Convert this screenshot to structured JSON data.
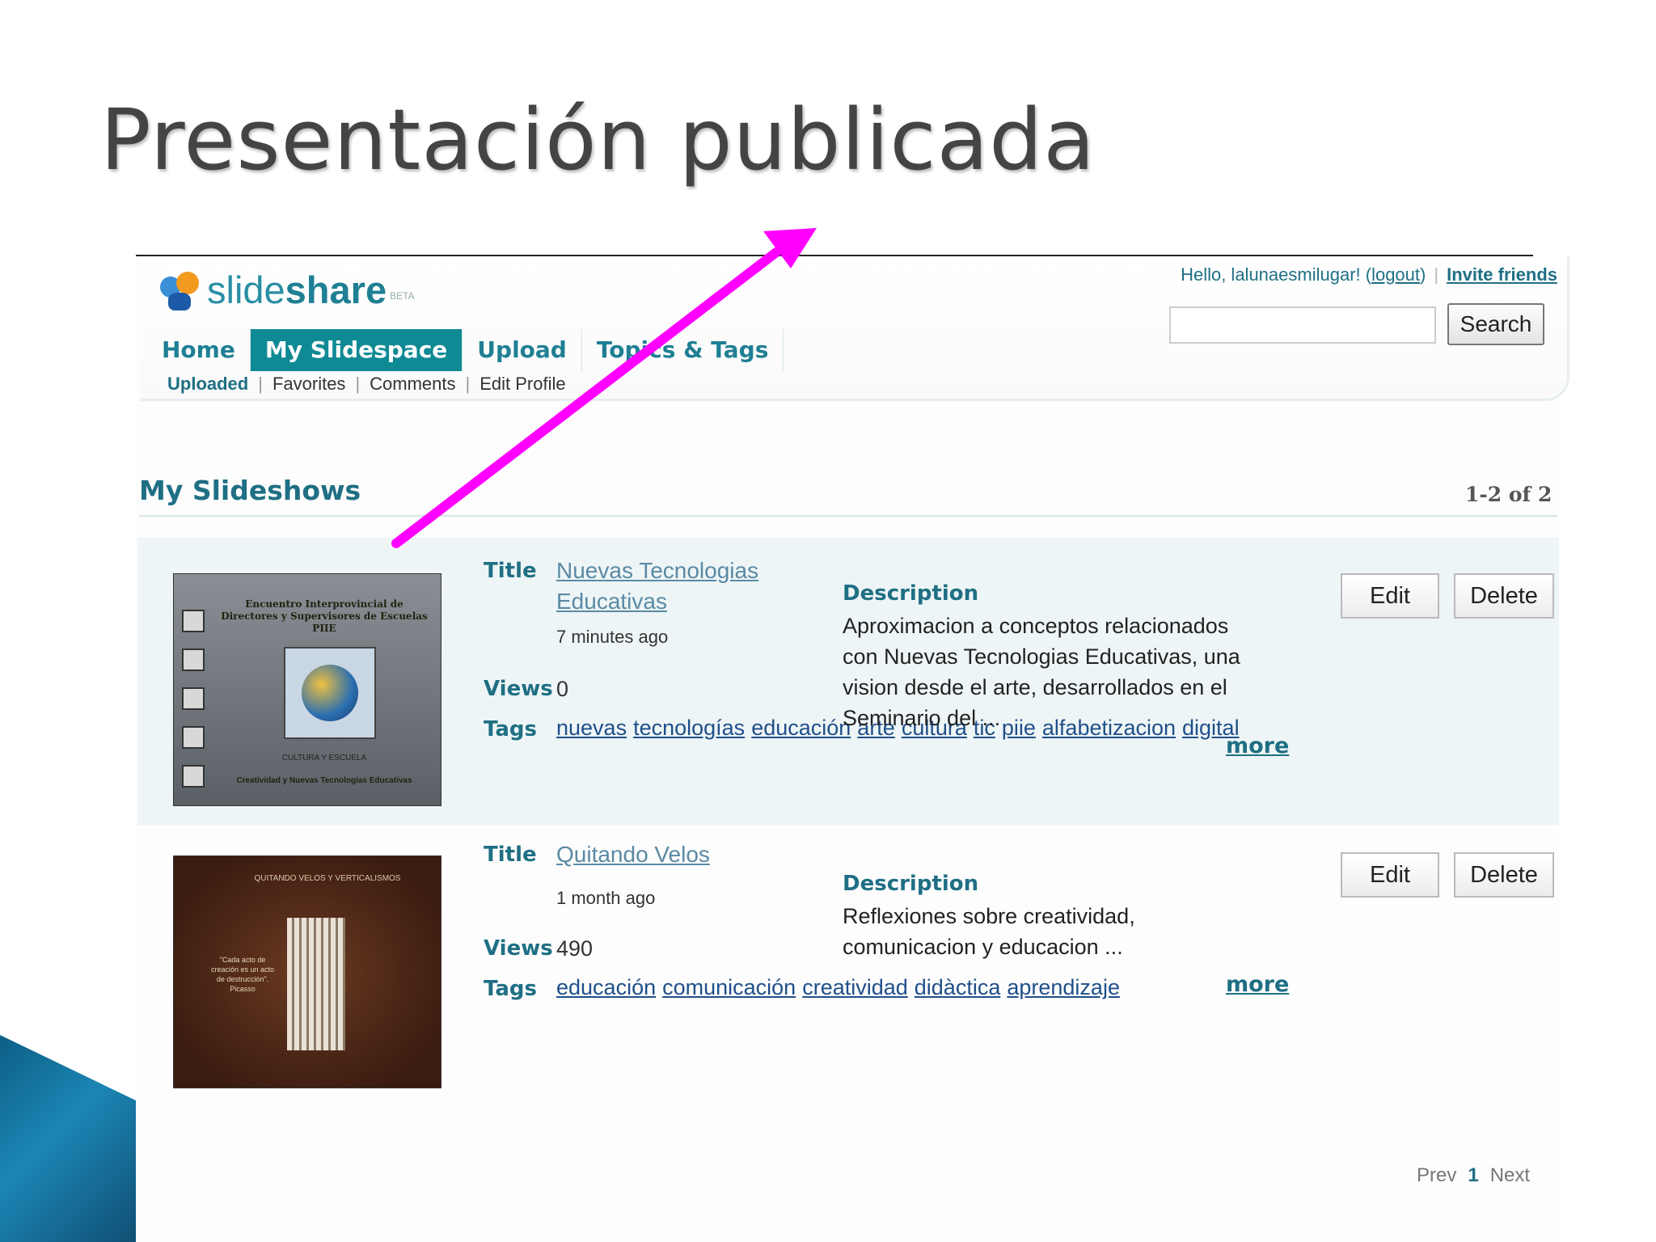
{
  "slide": {
    "title": "Presentación publicada"
  },
  "header": {
    "logo_light": "slide",
    "logo_bold": "share",
    "logo_beta": "BETA",
    "greeting": "Hello, lalunaesmilugar! (",
    "logout": "logout",
    "greeting_end": ")",
    "invite": "Invite friends",
    "search_value": "",
    "search_button": "Search",
    "nav": [
      "Home",
      "My Slidespace",
      "Upload",
      "Topics & Tags"
    ],
    "subnav": [
      "Uploaded",
      "Favorites",
      "Comments",
      "Edit Profile"
    ]
  },
  "section": {
    "title": "My Slideshows",
    "count": "1-2 of 2"
  },
  "labels": {
    "title": "Title",
    "views": "Views",
    "tags": "Tags",
    "description": "Description",
    "more": "more",
    "edit": "Edit",
    "delete": "Delete"
  },
  "slideshows": [
    {
      "title": "Nuevas Tecnologias Educativas",
      "age": "7 minutes ago",
      "views": "0",
      "tags": [
        "nuevas",
        "tecnologías",
        "educación",
        "arte",
        "cultura",
        "tic",
        "piie",
        "alfabetizacion",
        "digital"
      ],
      "description": "Aproximacion a conceptos relacionados con Nuevas Tecnologias Educativas, una vision desde el arte, desarrollados en el Seminario del ...",
      "thumb_heading": "Encuentro Interprovincial de Directores y Supervisores de Escuelas PIIE",
      "thumb_mid": "CULTURA Y ESCUELA",
      "thumb_foot": "Creatividad y Nuevas Tecnologías Educativas"
    },
    {
      "title": "Quitando Velos",
      "age": "1 month ago",
      "views": "490",
      "tags": [
        "educación",
        "comunicación",
        "creatividad",
        "didàctica",
        "aprendizaje"
      ],
      "description": "Reflexiones sobre creatividad, comunicacion y educacion ...",
      "thumb_heading": "QUITANDO VELOS Y VERTICALISMOS",
      "thumb_quote": "\"Cada acto de creación es un acto de destrucción\". Picasso"
    }
  ],
  "pagination": {
    "prev": "Prev",
    "current": "1",
    "next": "Next"
  },
  "colors": {
    "accent": "#1f6f84",
    "active_tab": "#0f8a94",
    "arrow": "#ff00ff",
    "row_highlight": "#eef5f6"
  }
}
